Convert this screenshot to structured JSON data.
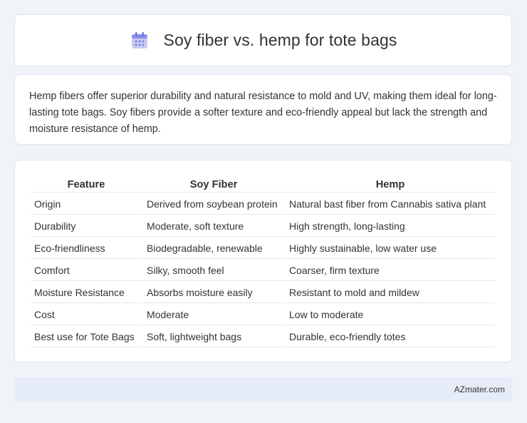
{
  "header": {
    "title": "Soy fiber vs. hemp for tote bags",
    "icon": "calendar-icon",
    "icon_color": "#7b7fe0"
  },
  "summary": {
    "text": "Hemp fibers offer superior durability and natural resistance to mold and UV, making them ideal for long-lasting tote bags. Soy fibers provide a softer texture and eco-friendly appeal but lack the strength and moisture resistance of hemp."
  },
  "table": {
    "headers": [
      "Feature",
      "Soy Fiber",
      "Hemp"
    ],
    "rows": [
      [
        "Origin",
        "Derived from soybean protein",
        "Natural bast fiber from Cannabis sativa plant"
      ],
      [
        "Durability",
        "Moderate, soft texture",
        "High strength, long-lasting"
      ],
      [
        "Eco-friendliness",
        "Biodegradable, renewable",
        "Highly sustainable, low water use"
      ],
      [
        "Comfort",
        "Silky, smooth feel",
        "Coarser, firm texture"
      ],
      [
        "Moisture Resistance",
        "Absorbs moisture easily",
        "Resistant to mold and mildew"
      ],
      [
        "Cost",
        "Moderate",
        "Low to moderate"
      ],
      [
        "Best use for Tote Bags",
        "Soft, lightweight bags",
        "Durable, eco-friendly totes"
      ]
    ]
  },
  "footer": {
    "brand": "AZmater.com"
  }
}
